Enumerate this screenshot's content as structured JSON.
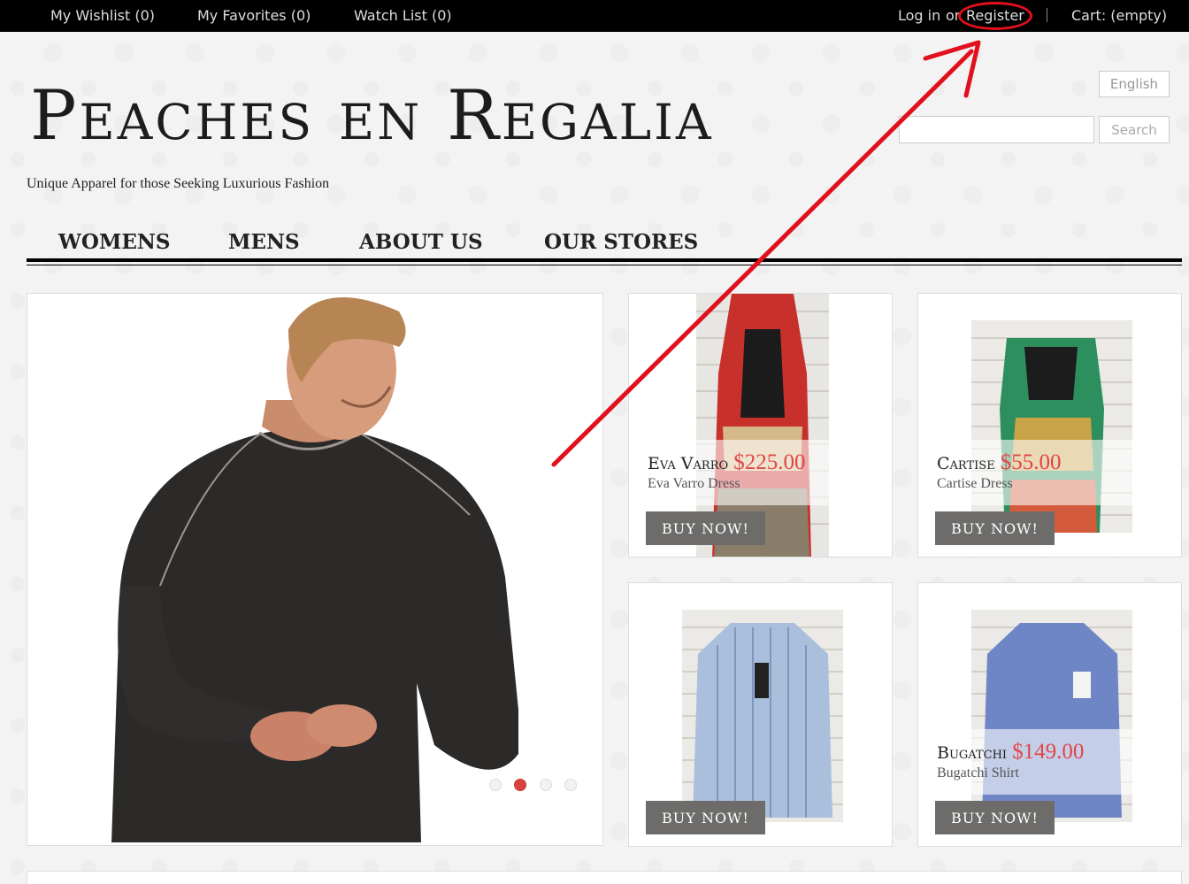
{
  "topbar": {
    "wishlist": "My Wishlist (0)",
    "favorites": "My Favorites (0)",
    "watchlist": "Watch List (0)",
    "login": "Log in",
    "or": "or",
    "register": "Register",
    "cart": "Cart: (empty)"
  },
  "header": {
    "logo": "Peaches en Regalia",
    "tagline": "Unique Apparel for those Seeking Luxurious Fashion",
    "language": "English",
    "search_button": "Search",
    "search_value": ""
  },
  "nav": [
    "WOMENS",
    "MENS",
    "ABOUT US",
    "OUR STORES"
  ],
  "carousel": {
    "slide_count": 4,
    "active_index": 1
  },
  "products": [
    {
      "brand": "Eva Varro",
      "price": "$225.00",
      "name": "Eva Varro Dress",
      "button": "BUY NOW!"
    },
    {
      "brand": "Cartise",
      "price": "$55.00",
      "name": "Cartise Dress",
      "button": "BUY NOW!"
    },
    {
      "brand": "",
      "price": "",
      "name": "",
      "button": "BUY NOW!"
    },
    {
      "brand": "Bugatchi",
      "price": "$149.00",
      "name": "Bugatchi Shirt",
      "button": "BUY NOW!"
    }
  ],
  "colors": {
    "topbar": "#000000",
    "price": "#e14545",
    "buy_button": "#6d6c6a",
    "annotation": "#e0101d"
  }
}
